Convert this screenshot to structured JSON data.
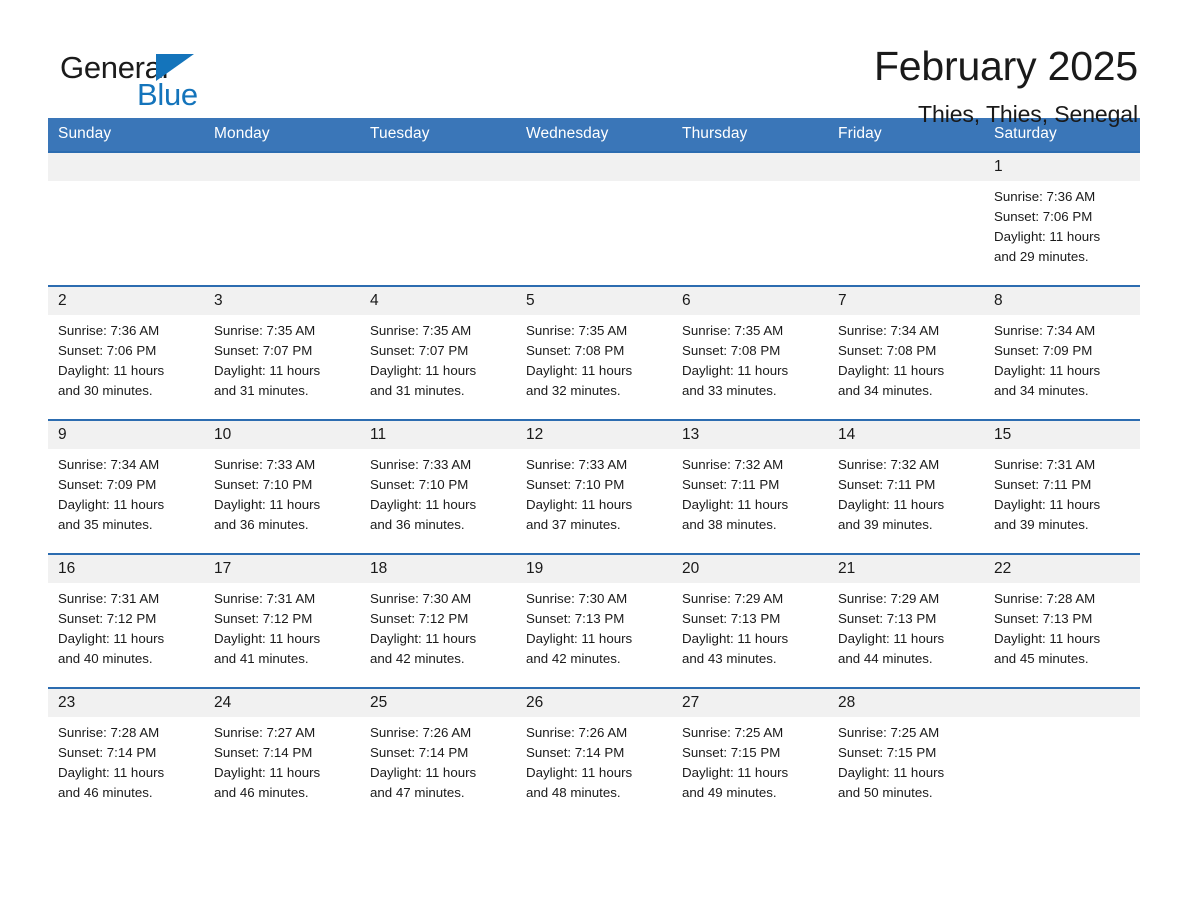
{
  "brand": {
    "name_part1": "General",
    "name_part2": "Blue",
    "accent_color": "#1474bb"
  },
  "header": {
    "month_title": "February 2025",
    "location": "Thies, Thies, Senegal",
    "header_bg_color": "#3a76b8",
    "row_border_color": "#2c6cb0",
    "daynum_bg_color": "#f1f1f1"
  },
  "weekdays": [
    "Sunday",
    "Monday",
    "Tuesday",
    "Wednesday",
    "Thursday",
    "Friday",
    "Saturday"
  ],
  "weeks": [
    [
      {
        "day": "",
        "blank": true
      },
      {
        "day": "",
        "blank": true
      },
      {
        "day": "",
        "blank": true
      },
      {
        "day": "",
        "blank": true
      },
      {
        "day": "",
        "blank": true
      },
      {
        "day": "",
        "blank": true
      },
      {
        "day": "1",
        "sunrise": "Sunrise: 7:36 AM",
        "sunset": "Sunset: 7:06 PM",
        "daylight_line1": "Daylight: 11 hours",
        "daylight_line2": "and 29 minutes."
      }
    ],
    [
      {
        "day": "2",
        "sunrise": "Sunrise: 7:36 AM",
        "sunset": "Sunset: 7:06 PM",
        "daylight_line1": "Daylight: 11 hours",
        "daylight_line2": "and 30 minutes."
      },
      {
        "day": "3",
        "sunrise": "Sunrise: 7:35 AM",
        "sunset": "Sunset: 7:07 PM",
        "daylight_line1": "Daylight: 11 hours",
        "daylight_line2": "and 31 minutes."
      },
      {
        "day": "4",
        "sunrise": "Sunrise: 7:35 AM",
        "sunset": "Sunset: 7:07 PM",
        "daylight_line1": "Daylight: 11 hours",
        "daylight_line2": "and 31 minutes."
      },
      {
        "day": "5",
        "sunrise": "Sunrise: 7:35 AM",
        "sunset": "Sunset: 7:08 PM",
        "daylight_line1": "Daylight: 11 hours",
        "daylight_line2": "and 32 minutes."
      },
      {
        "day": "6",
        "sunrise": "Sunrise: 7:35 AM",
        "sunset": "Sunset: 7:08 PM",
        "daylight_line1": "Daylight: 11 hours",
        "daylight_line2": "and 33 minutes."
      },
      {
        "day": "7",
        "sunrise": "Sunrise: 7:34 AM",
        "sunset": "Sunset: 7:08 PM",
        "daylight_line1": "Daylight: 11 hours",
        "daylight_line2": "and 34 minutes."
      },
      {
        "day": "8",
        "sunrise": "Sunrise: 7:34 AM",
        "sunset": "Sunset: 7:09 PM",
        "daylight_line1": "Daylight: 11 hours",
        "daylight_line2": "and 34 minutes."
      }
    ],
    [
      {
        "day": "9",
        "sunrise": "Sunrise: 7:34 AM",
        "sunset": "Sunset: 7:09 PM",
        "daylight_line1": "Daylight: 11 hours",
        "daylight_line2": "and 35 minutes."
      },
      {
        "day": "10",
        "sunrise": "Sunrise: 7:33 AM",
        "sunset": "Sunset: 7:10 PM",
        "daylight_line1": "Daylight: 11 hours",
        "daylight_line2": "and 36 minutes."
      },
      {
        "day": "11",
        "sunrise": "Sunrise: 7:33 AM",
        "sunset": "Sunset: 7:10 PM",
        "daylight_line1": "Daylight: 11 hours",
        "daylight_line2": "and 36 minutes."
      },
      {
        "day": "12",
        "sunrise": "Sunrise: 7:33 AM",
        "sunset": "Sunset: 7:10 PM",
        "daylight_line1": "Daylight: 11 hours",
        "daylight_line2": "and 37 minutes."
      },
      {
        "day": "13",
        "sunrise": "Sunrise: 7:32 AM",
        "sunset": "Sunset: 7:11 PM",
        "daylight_line1": "Daylight: 11 hours",
        "daylight_line2": "and 38 minutes."
      },
      {
        "day": "14",
        "sunrise": "Sunrise: 7:32 AM",
        "sunset": "Sunset: 7:11 PM",
        "daylight_line1": "Daylight: 11 hours",
        "daylight_line2": "and 39 minutes."
      },
      {
        "day": "15",
        "sunrise": "Sunrise: 7:31 AM",
        "sunset": "Sunset: 7:11 PM",
        "daylight_line1": "Daylight: 11 hours",
        "daylight_line2": "and 39 minutes."
      }
    ],
    [
      {
        "day": "16",
        "sunrise": "Sunrise: 7:31 AM",
        "sunset": "Sunset: 7:12 PM",
        "daylight_line1": "Daylight: 11 hours",
        "daylight_line2": "and 40 minutes."
      },
      {
        "day": "17",
        "sunrise": "Sunrise: 7:31 AM",
        "sunset": "Sunset: 7:12 PM",
        "daylight_line1": "Daylight: 11 hours",
        "daylight_line2": "and 41 minutes."
      },
      {
        "day": "18",
        "sunrise": "Sunrise: 7:30 AM",
        "sunset": "Sunset: 7:12 PM",
        "daylight_line1": "Daylight: 11 hours",
        "daylight_line2": "and 42 minutes."
      },
      {
        "day": "19",
        "sunrise": "Sunrise: 7:30 AM",
        "sunset": "Sunset: 7:13 PM",
        "daylight_line1": "Daylight: 11 hours",
        "daylight_line2": "and 42 minutes."
      },
      {
        "day": "20",
        "sunrise": "Sunrise: 7:29 AM",
        "sunset": "Sunset: 7:13 PM",
        "daylight_line1": "Daylight: 11 hours",
        "daylight_line2": "and 43 minutes."
      },
      {
        "day": "21",
        "sunrise": "Sunrise: 7:29 AM",
        "sunset": "Sunset: 7:13 PM",
        "daylight_line1": "Daylight: 11 hours",
        "daylight_line2": "and 44 minutes."
      },
      {
        "day": "22",
        "sunrise": "Sunrise: 7:28 AM",
        "sunset": "Sunset: 7:13 PM",
        "daylight_line1": "Daylight: 11 hours",
        "daylight_line2": "and 45 minutes."
      }
    ],
    [
      {
        "day": "23",
        "sunrise": "Sunrise: 7:28 AM",
        "sunset": "Sunset: 7:14 PM",
        "daylight_line1": "Daylight: 11 hours",
        "daylight_line2": "and 46 minutes."
      },
      {
        "day": "24",
        "sunrise": "Sunrise: 7:27 AM",
        "sunset": "Sunset: 7:14 PM",
        "daylight_line1": "Daylight: 11 hours",
        "daylight_line2": "and 46 minutes."
      },
      {
        "day": "25",
        "sunrise": "Sunrise: 7:26 AM",
        "sunset": "Sunset: 7:14 PM",
        "daylight_line1": "Daylight: 11 hours",
        "daylight_line2": "and 47 minutes."
      },
      {
        "day": "26",
        "sunrise": "Sunrise: 7:26 AM",
        "sunset": "Sunset: 7:14 PM",
        "daylight_line1": "Daylight: 11 hours",
        "daylight_line2": "and 48 minutes."
      },
      {
        "day": "27",
        "sunrise": "Sunrise: 7:25 AM",
        "sunset": "Sunset: 7:15 PM",
        "daylight_line1": "Daylight: 11 hours",
        "daylight_line2": "and 49 minutes."
      },
      {
        "day": "28",
        "sunrise": "Sunrise: 7:25 AM",
        "sunset": "Sunset: 7:15 PM",
        "daylight_line1": "Daylight: 11 hours",
        "daylight_line2": "and 50 minutes."
      },
      {
        "day": "",
        "blank": true
      }
    ]
  ]
}
